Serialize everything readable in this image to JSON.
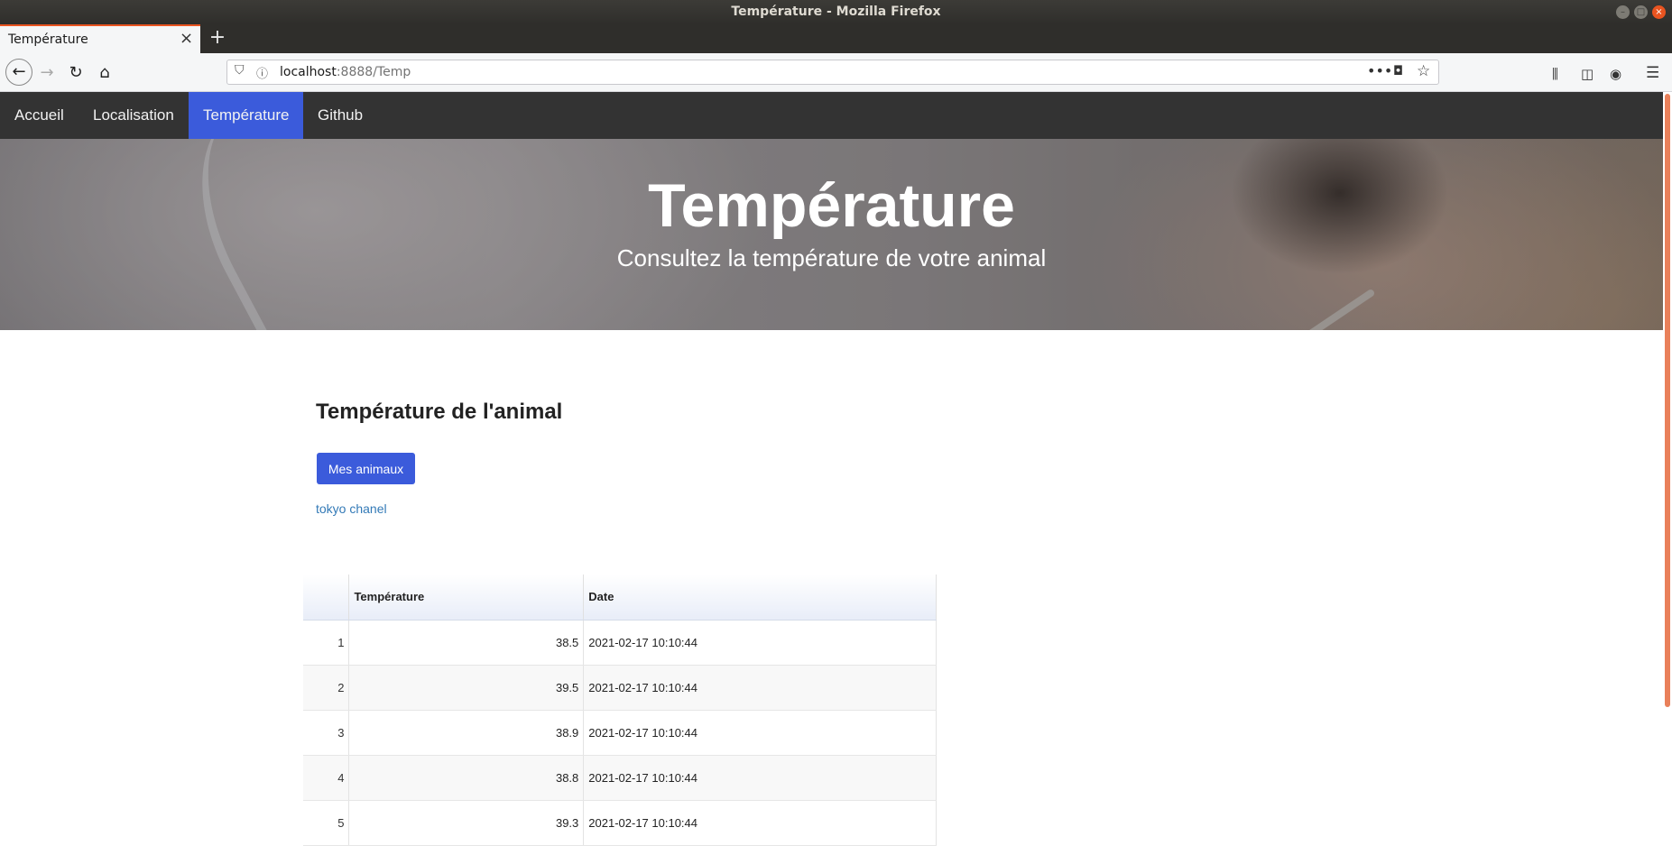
{
  "window": {
    "title": "Température - Mozilla Firefox"
  },
  "browser": {
    "tab_title": "Température",
    "url_host": "localhost",
    "url_path": ":8888/Temp"
  },
  "site_nav": {
    "items": [
      "Accueil",
      "Localisation",
      "Température",
      "Github"
    ],
    "active": "Température",
    "active_color": "#3b5bdb"
  },
  "hero": {
    "title": "Température",
    "subtitle": "Consultez la température de votre animal"
  },
  "main": {
    "section_title": "Température de l'animal",
    "button_label": "Mes animaux",
    "animal_link": "tokyo chanel"
  },
  "table": {
    "headers": [
      "",
      "Température",
      "Date"
    ],
    "rows": [
      {
        "index": "1",
        "temperature": "38.5",
        "date": "2021-02-17 10:10:44"
      },
      {
        "index": "2",
        "temperature": "39.5",
        "date": "2021-02-17 10:10:44"
      },
      {
        "index": "3",
        "temperature": "38.9",
        "date": "2021-02-17 10:10:44"
      },
      {
        "index": "4",
        "temperature": "38.8",
        "date": "2021-02-17 10:10:44"
      },
      {
        "index": "5",
        "temperature": "39.3",
        "date": "2021-02-17 10:10:44"
      }
    ]
  }
}
